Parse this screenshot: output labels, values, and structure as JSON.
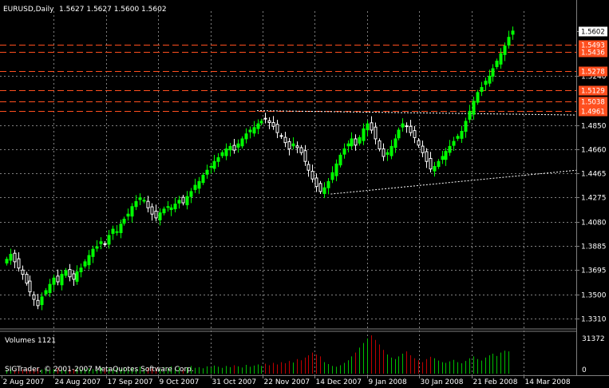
{
  "header": {
    "symbol": "EURUSD,Daily",
    "ohlc": "1.5627 1.5627 1.5600 1.5602"
  },
  "volume_panel": {
    "label": "Volumes 1121",
    "scale_max": "31372",
    "scale_min": "0"
  },
  "watermark": "SIGTrader, © 2001-2007 MetaQuotes Software Corp.",
  "colors": {
    "background": "#000000",
    "up_candle": "#00ff00",
    "down_candle": "#ffffff",
    "grid": "#7f7f7f",
    "level_line": "#ff4f1f",
    "level_label_bg": "#ff4f1f",
    "volume_up": "#00c000",
    "volume_down": "#c00000"
  },
  "chart_data": {
    "type": "candlestick",
    "symbol": "EURUSD",
    "timeframe": "Daily",
    "current_price": "1.5602",
    "ylim": [
      1.325,
      1.572
    ],
    "price_ticks": [
      "1.5602",
      "1.5240",
      "1.4850",
      "1.4660",
      "1.4465",
      "1.4275",
      "1.4080",
      "1.3885",
      "1.3695",
      "1.3500",
      "1.3310"
    ],
    "price_tick_values": [
      1.5602,
      1.524,
      1.485,
      1.466,
      1.4465,
      1.4275,
      1.408,
      1.3885,
      1.3695,
      1.35,
      1.331
    ],
    "date_ticks": [
      "2 Aug 2007",
      "24 Aug 2007",
      "17 Sep 2007",
      "9 Oct 2007",
      "31 Oct 2007",
      "22 Nov 2007",
      "14 Dec 2007",
      "9 Jan 2008",
      "30 Jan 2008",
      "21 Feb 2008",
      "14 Mar 2008"
    ],
    "levels": [
      "1.5493",
      "1.5436",
      "1.5278",
      "1.5129",
      "1.5038",
      "1.4961"
    ],
    "level_values": [
      1.5493,
      1.5436,
      1.5278,
      1.5129,
      1.5038,
      1.4961
    ],
    "trendlines": [
      {
        "style": "dashed",
        "from": {
          "date": "15 Nov 2007",
          "price": 1.4965
        },
        "to": {
          "date": "27 Mar 2008",
          "price": 1.493
        }
      },
      {
        "style": "dashed",
        "from": {
          "date": "14 Dec 2007",
          "price": 1.43
        },
        "to": {
          "date": "27 Mar 2008",
          "price": 1.449
        }
      }
    ],
    "closes": [
      1.378,
      1.382,
      1.376,
      1.371,
      1.366,
      1.359,
      1.352,
      1.346,
      1.341,
      1.348,
      1.353,
      1.358,
      1.363,
      1.36,
      1.366,
      1.369,
      1.364,
      1.362,
      1.368,
      1.371,
      1.376,
      1.381,
      1.386,
      1.388,
      1.392,
      1.39,
      1.397,
      1.402,
      1.4,
      1.406,
      1.41,
      1.414,
      1.42,
      1.424,
      1.427,
      1.425,
      1.419,
      1.414,
      1.411,
      1.415,
      1.418,
      1.42,
      1.419,
      1.422,
      1.425,
      1.423,
      1.428,
      1.432,
      1.437,
      1.44,
      1.445,
      1.449,
      1.452,
      1.456,
      1.459,
      1.463,
      1.466,
      1.468,
      1.465,
      1.47,
      1.474,
      1.478,
      1.481,
      1.483,
      1.486,
      1.488,
      1.49,
      1.487,
      1.484,
      1.479,
      1.476,
      1.471,
      1.466,
      1.47,
      1.467,
      1.463,
      1.456,
      1.449,
      1.442,
      1.436,
      1.432,
      1.435,
      1.44,
      1.447,
      1.454,
      1.461,
      1.466,
      1.47,
      1.474,
      1.469,
      1.475,
      1.482,
      1.486,
      1.481,
      1.474,
      1.466,
      1.46,
      1.463,
      1.468,
      1.474,
      1.481,
      1.486,
      1.484,
      1.479,
      1.475,
      1.469,
      1.463,
      1.456,
      1.45,
      1.452,
      1.456,
      1.46,
      1.464,
      1.468,
      1.472,
      1.476,
      1.48,
      1.488,
      1.496,
      1.504,
      1.511,
      1.515,
      1.52,
      1.524,
      1.53,
      1.536,
      1.542,
      1.548,
      1.555,
      1.56
    ],
    "volumes": [
      0.1,
      0.12,
      0.09,
      0.14,
      0.11,
      0.13,
      0.1,
      0.12,
      0.15,
      0.11,
      0.13,
      0.1,
      0.12,
      0.14,
      0.11,
      0.1,
      0.13,
      0.12,
      0.15,
      0.11,
      0.13,
      0.14,
      0.12,
      0.1,
      0.16,
      0.13,
      0.15,
      0.11,
      0.14,
      0.12,
      0.17,
      0.13,
      0.15,
      0.12,
      0.18,
      0.14,
      0.16,
      0.13,
      0.15,
      0.12,
      0.17,
      0.14,
      0.19,
      0.15,
      0.18,
      0.13,
      0.16,
      0.2,
      0.15,
      0.17,
      0.14,
      0.19,
      0.16,
      0.21,
      0.18,
      0.15,
      0.2,
      0.17,
      0.22,
      0.19,
      0.16,
      0.23,
      0.18,
      0.21,
      0.24,
      0.2,
      0.26,
      0.22,
      0.28,
      0.24,
      0.3,
      0.27,
      0.33,
      0.29,
      0.38,
      0.35,
      0.42,
      0.48,
      0.55,
      0.5,
      0.45,
      0.3,
      0.25,
      0.2,
      0.18,
      0.22,
      0.28,
      0.35,
      0.45,
      0.55,
      0.68,
      0.8,
      0.92,
      1.0,
      0.88,
      0.76,
      0.62,
      0.5,
      0.42,
      0.38,
      0.45,
      0.52,
      0.58,
      0.48,
      0.4,
      0.35,
      0.3,
      0.38,
      0.44,
      0.4,
      0.34,
      0.3,
      0.28,
      0.32,
      0.36,
      0.3,
      0.27,
      0.33,
      0.4,
      0.45,
      0.38,
      0.34,
      0.42,
      0.48,
      0.52,
      0.46,
      0.55,
      0.6,
      0.58
    ]
  }
}
